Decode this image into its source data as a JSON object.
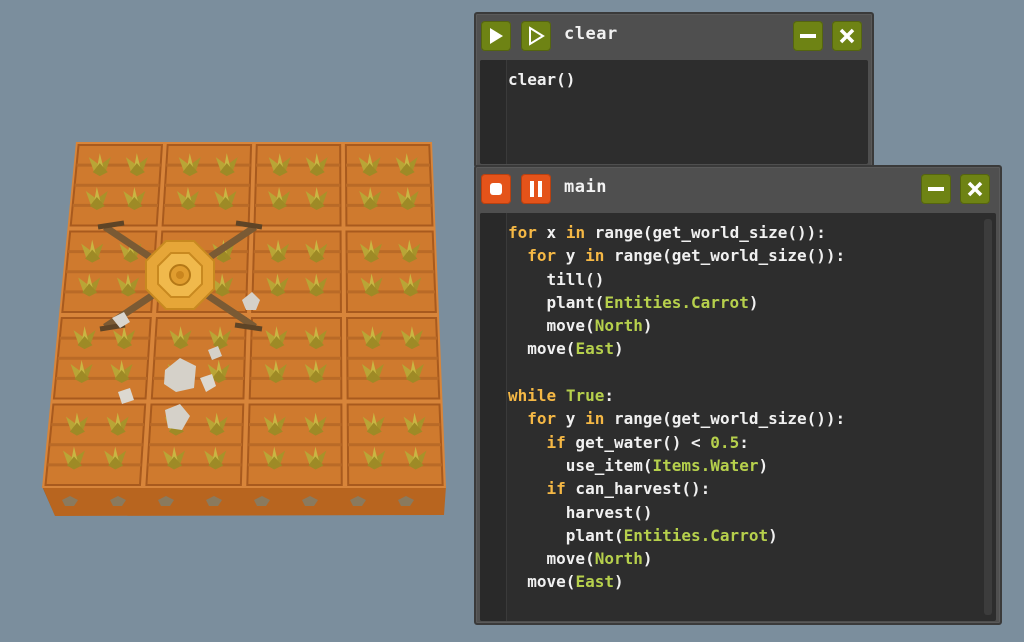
{
  "windows": {
    "clear": {
      "title": "clear",
      "code": [
        [
          [
            "fn",
            "clear()"
          ]
        ]
      ],
      "buttons": {
        "run": "play-icon",
        "step": "play-outline-icon",
        "minimize": "minimize-icon",
        "close": "close-icon"
      }
    },
    "main": {
      "title": "main",
      "code": [
        [
          [
            "kw",
            "for"
          ],
          [
            "fn",
            " x "
          ],
          [
            "kw",
            "in"
          ],
          [
            "fn",
            " range(get_world_size()):"
          ]
        ],
        [
          [
            "fn",
            "  "
          ],
          [
            "kw",
            "for"
          ],
          [
            "fn",
            " y "
          ],
          [
            "kw",
            "in"
          ],
          [
            "fn",
            " range(get_world_size()):"
          ]
        ],
        [
          [
            "fn",
            "    till()"
          ]
        ],
        [
          [
            "fn",
            "    plant("
          ],
          [
            "ent",
            "Entities.Carrot"
          ],
          [
            "fn",
            ")"
          ]
        ],
        [
          [
            "fn",
            "    move("
          ],
          [
            "ent",
            "North"
          ],
          [
            "fn",
            ")"
          ]
        ],
        [
          [
            "fn",
            "  move("
          ],
          [
            "ent",
            "East"
          ],
          [
            "fn",
            ")"
          ]
        ],
        [
          [
            "fn",
            ""
          ]
        ],
        [
          [
            "kw",
            "while"
          ],
          [
            "fn",
            " "
          ],
          [
            "ent",
            "True"
          ],
          [
            "fn",
            ":"
          ]
        ],
        [
          [
            "fn",
            "  "
          ],
          [
            "kw",
            "for"
          ],
          [
            "fn",
            " y "
          ],
          [
            "kw",
            "in"
          ],
          [
            "fn",
            " range(get_world_size()):"
          ]
        ],
        [
          [
            "fn",
            "    "
          ],
          [
            "kw",
            "if"
          ],
          [
            "fn",
            " get_water() < "
          ],
          [
            "num",
            "0.5"
          ],
          [
            "fn",
            ":"
          ]
        ],
        [
          [
            "fn",
            "      use_item("
          ],
          [
            "ent",
            "Items.Water"
          ],
          [
            "fn",
            ")"
          ]
        ],
        [
          [
            "fn",
            "    "
          ],
          [
            "kw",
            "if"
          ],
          [
            "fn",
            " can_harvest():"
          ]
        ],
        [
          [
            "fn",
            "      harvest()"
          ]
        ],
        [
          [
            "fn",
            "      plant("
          ],
          [
            "ent",
            "Entities.Carrot"
          ],
          [
            "fn",
            ")"
          ]
        ],
        [
          [
            "fn",
            "    move("
          ],
          [
            "ent",
            "North"
          ],
          [
            "fn",
            ")"
          ]
        ],
        [
          [
            "fn",
            "  move("
          ],
          [
            "ent",
            "East"
          ],
          [
            "fn",
            ")"
          ]
        ]
      ],
      "buttons": {
        "stop": "stop-icon",
        "pause": "pause-icon",
        "minimize": "minimize-icon",
        "close": "close-icon"
      }
    }
  },
  "farm": {
    "grid_size": 4,
    "crop": "carrot",
    "drone": "drone-icon"
  },
  "colors": {
    "background": "#7b8e9d",
    "soil": "#cf7a2e",
    "soil_dark": "#a85a1e",
    "leaf": "#b9a536",
    "green_button": "#6e8314",
    "orange_button": "#e4531a",
    "keyword": "#f5b845",
    "entity": "#b6d04c"
  }
}
